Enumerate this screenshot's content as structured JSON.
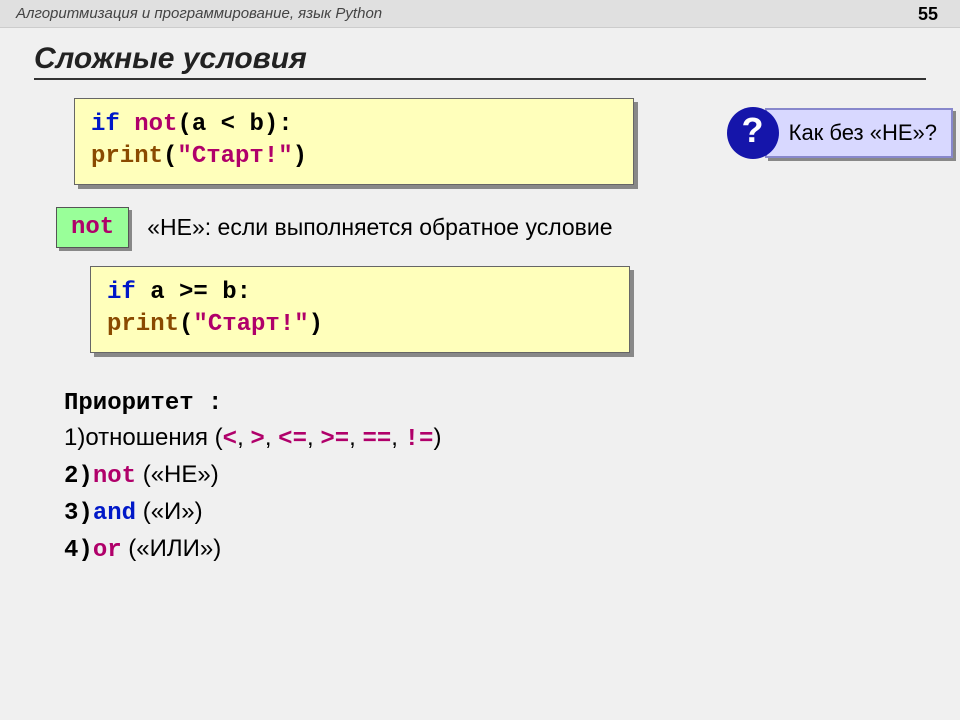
{
  "header": {
    "title": "Алгоритмизация и программирование, язык Python",
    "page": "55"
  },
  "slide": {
    "title": "Сложные условия"
  },
  "code1": {
    "if": "if",
    "not": "not",
    "lp": "(",
    "expr": "a < b",
    "rp": "):",
    "indent": "   ",
    "fn": "print",
    "args_l": "(",
    "args_s": "\"Старт!\"",
    "args_r": ")"
  },
  "callout": {
    "q": "?",
    "text": "Как без «НЕ»?"
  },
  "notline": {
    "badge": "not",
    "desc": "«НЕ»: если выполняется обратное условие"
  },
  "code2": {
    "if": "if",
    "expr": " a >= b:",
    "indent": "   ",
    "fn": "print",
    "args_l": "(",
    "args_s": "\"Старт!\"",
    "args_r": ")"
  },
  "priority": {
    "title": "Приоритет :",
    "l1a": "1)отношения (",
    "l1b": "<",
    "l1c": ", ",
    "l1d": ">",
    "l1e": ", ",
    "l1f": "<=",
    "l1g": ", ",
    "l1h": ">=",
    "l1i": ", ",
    "l1j": "==",
    "l1k": ", ",
    "l1l": "!=",
    "l1m": ")",
    "l2a": "2)",
    "l2b": "not",
    "l2c": " («НЕ»)",
    "l3a": "3)",
    "l3b": "and",
    "l3c": " («И»)",
    "l4a": "4)",
    "l4b": "or",
    "l4c": " («ИЛИ»)"
  }
}
